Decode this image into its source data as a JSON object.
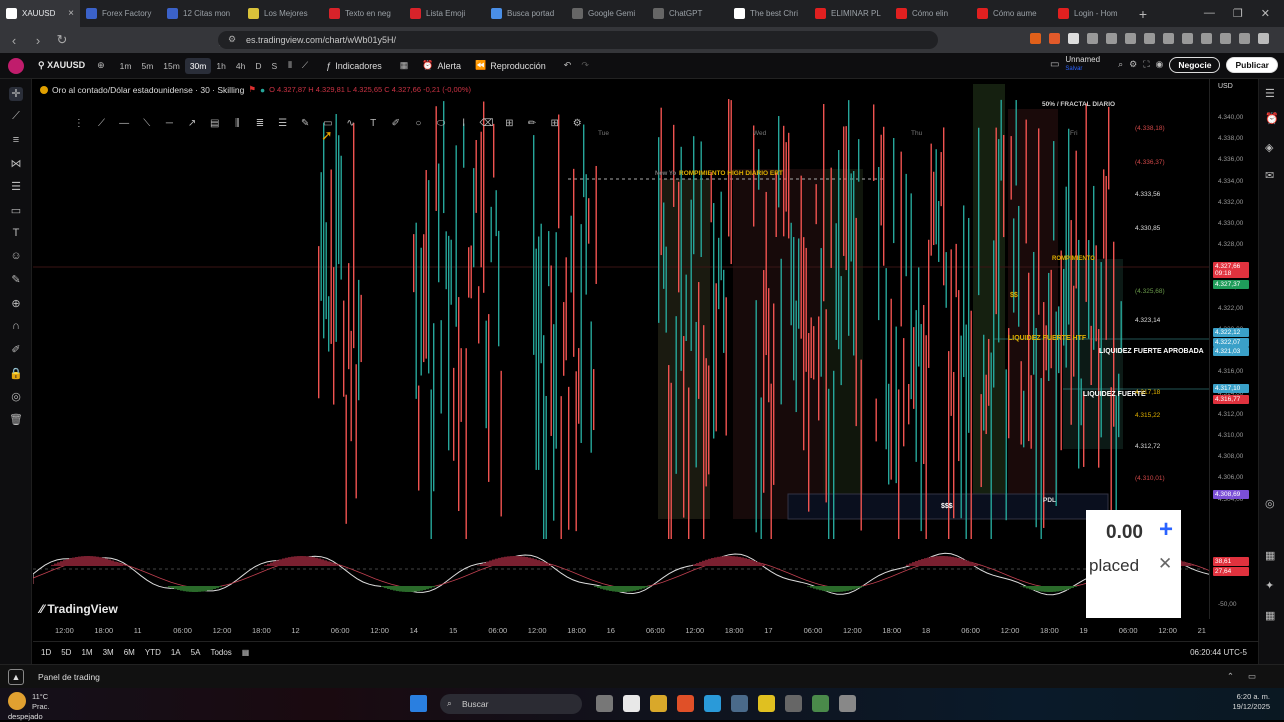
{
  "browser": {
    "tabs": [
      {
        "label": "XAUUSD",
        "color": "#ffffff"
      },
      {
        "label": "Forex Factory",
        "color": "#3b62c9"
      },
      {
        "label": "12 Citas mon",
        "color": "#3b62c9"
      },
      {
        "label": "Los Mejores",
        "color": "#d9c23a"
      },
      {
        "label": "Texto en neg",
        "color": "#d8232a"
      },
      {
        "label": "Lista Emoji",
        "color": "#d8232a"
      },
      {
        "label": "Busca portad",
        "color": "#4a8fe7"
      },
      {
        "label": "Google Gemi",
        "color": "#666666"
      },
      {
        "label": "ChatGPT",
        "color": "#666666"
      },
      {
        "label": "The best Chri",
        "color": "#ffffff"
      },
      {
        "label": "ELIMINAR PL",
        "color": "#e02020"
      },
      {
        "label": "Cómo elin",
        "color": "#e02020"
      },
      {
        "label": "Cómo aume",
        "color": "#e02020"
      },
      {
        "label": "Login - Hom",
        "color": "#e02020"
      }
    ],
    "url": "es.tradingview.com/chart/wWb01y5H/"
  },
  "toolbar": {
    "symbol": "XAUUSD",
    "timeframes": [
      "1m",
      "5m",
      "15m",
      "30m",
      "1h",
      "4h",
      "D",
      "S"
    ],
    "active_timeframe": "30m",
    "indicators_label": "Indicadores",
    "alert_label": "Alerta",
    "replay_label": "Reproducción",
    "layout_name": "Unnamed",
    "layout_sub": "Salvar",
    "trade_label": "Negocie",
    "publish_label": "Publicar"
  },
  "legend": {
    "title": "Oro al contado/Dólar estadounidense · 30 · Skilling",
    "ohlc": "O 4.327,87  H 4.329,81  L 4.325,65  C 4.327,66  -0,21 (-0,00%)"
  },
  "price_axis": {
    "currency": "USD",
    "labels": [
      "4.340,00",
      "4.338,00",
      "4.336,00",
      "4.334,00",
      "4.332,00",
      "4.330,00",
      "4.328,00",
      "4.326,00",
      "4.324,00",
      "4.322,00",
      "4.320,00",
      "4.318,00",
      "4.316,00",
      "4.314,00",
      "4.312,00",
      "4.310,00",
      "4.308,00",
      "4.306,00",
      "4.304,00"
    ],
    "tags": [
      {
        "text": "4.327,66",
        "color": "#e0323e"
      },
      {
        "text": "09:18",
        "color": "#e0323e"
      },
      {
        "text": "4.327,37",
        "color": "#1f9c5a"
      },
      {
        "text": "4.322,12",
        "color": "#3aa0c8"
      },
      {
        "text": "4.322,07",
        "color": "#3aa0c8"
      },
      {
        "text": "4.321,03",
        "color": "#3aa0c8"
      },
      {
        "text": "4.317,10",
        "color": "#3aa0c8"
      },
      {
        "text": "4.316,77",
        "color": "#e0323e"
      },
      {
        "text": "4.308,69",
        "color": "#7b4fd6"
      }
    ],
    "osc_labels": [
      "38,61",
      "27,64",
      "-50,00"
    ]
  },
  "fib_levels": [
    "(4.338,18)",
    "(4.336,37)",
    "4.333,56",
    "4.330,85",
    "(4.325,68)",
    "4.323,14",
    "4.317,18",
    "4.315,22",
    "4.312,72",
    "(4.310,01)"
  ],
  "annotations": {
    "fractal": "50% / FRACTAL DIARIO",
    "rompimiento_high": "ROMPIMIENTO HIGH DIARIO ERT",
    "new_york": "New Yo",
    "rompimiento": "ROMPIMIENTO",
    "liquidez_htf": "LIQUIDEZ FUERTE HTF",
    "liquidez_aprobada": "LIQUIDEZ FUERTE APROBADA",
    "liquidez_fuerte": "LIQUIDEZ FUERTE",
    "dollars": "$$$",
    "pdl": "PDL",
    "ss": "$$",
    "day_tue": "Tue",
    "day_wed": "Wed",
    "day_thu": "Thu",
    "day_fri": "Fri"
  },
  "time_axis": [
    "12:00",
    "18:00",
    "11",
    "06:00",
    "12:00",
    "18:00",
    "12",
    "06:00",
    "12:00",
    "14",
    "15",
    "06:00",
    "12:00",
    "18:00",
    "16",
    "06:00",
    "12:00",
    "18:00",
    "17",
    "06:00",
    "12:00",
    "18:00",
    "18",
    "06:00",
    "12:00",
    "18:00",
    "19",
    "06:00",
    "12:00",
    "21"
  ],
  "ranges": [
    "1D",
    "5D",
    "1M",
    "3M",
    "6M",
    "YTD",
    "1A",
    "5A",
    "Todos"
  ],
  "clock": "06:20:44 UTC-5",
  "panel_label": "Panel de trading",
  "brand": "TradingView",
  "popup": {
    "value": "0.00",
    "label": "placed"
  },
  "taskbar": {
    "search_placeholder": "Buscar",
    "temperature": "11°C",
    "weather": "Prac. despejado",
    "time": "6:20 a. m.",
    "date": "19/12/2025"
  },
  "colors": {
    "up": "#26a69a",
    "down": "#ef5350",
    "accent": "#2962ff"
  }
}
